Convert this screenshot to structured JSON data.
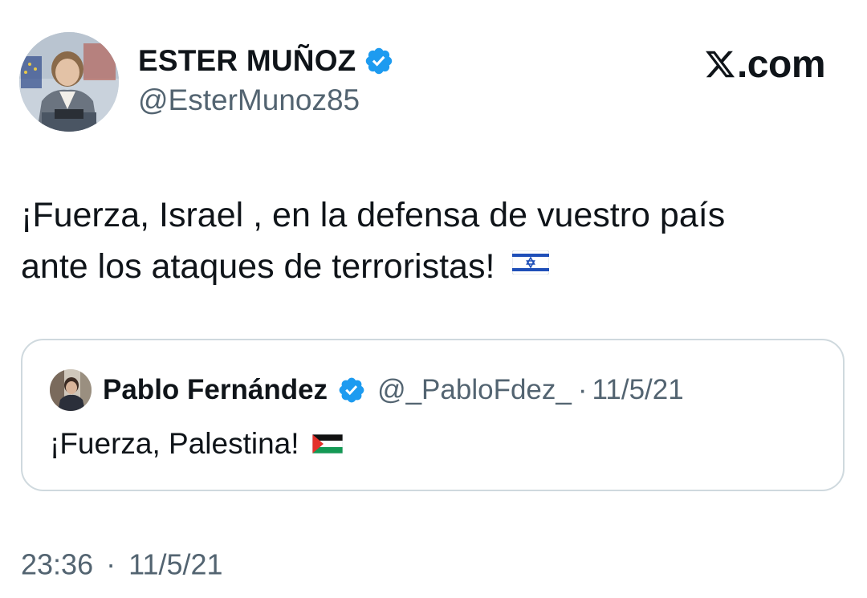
{
  "author": {
    "name": "ESTER MUÑOZ",
    "handle": "@EsterMunoz85",
    "verified": true,
    "avatar_icon": "person-avatar"
  },
  "brand": {
    "logo_icon": "x-logo-icon",
    "domain": ".com"
  },
  "tweet": {
    "line1": "¡Fuerza, Israel , en la defensa de vuestro país",
    "line2": "ante los ataques de terroristas!",
    "flag_icon": "israel-flag-icon"
  },
  "quoted_tweet": {
    "author_name": "Pablo Fernández",
    "author_handle": "@_PabloFdez_",
    "separator": "·",
    "date": "11/5/21",
    "text": "¡Fuerza, Palestina!",
    "flag_icon": "palestine-flag-icon",
    "verified": true
  },
  "footer": {
    "time": "23:36",
    "separator": "·",
    "date": "11/5/21"
  },
  "colors": {
    "verified_blue": "#1d9bf0",
    "text_primary": "#0f1419",
    "text_secondary": "#536471",
    "border": "#cfd9de"
  }
}
